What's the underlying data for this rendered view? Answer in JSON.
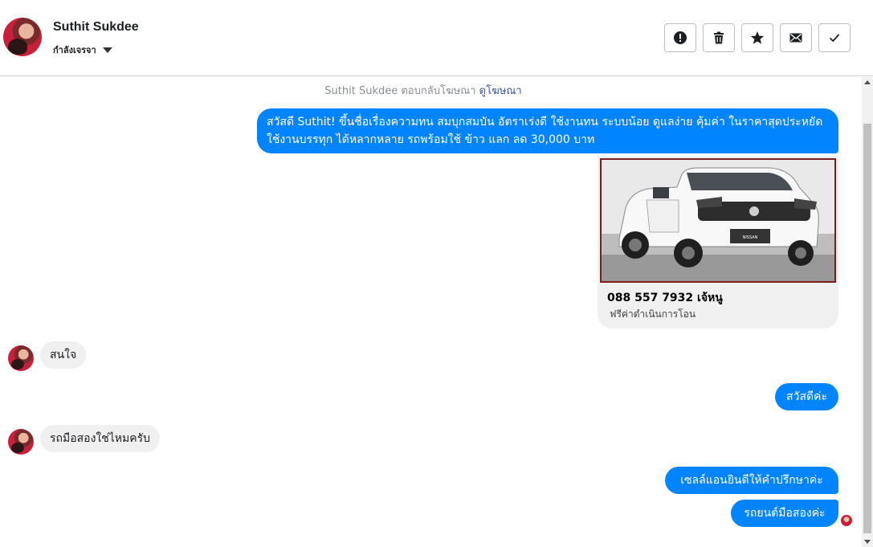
{
  "header": {
    "contact_name": "Suthit Sukdee",
    "stage_label": "กำลังเจรจา",
    "actions": [
      {
        "name": "spam-button",
        "icon": "exclamation-circle-icon"
      },
      {
        "name": "delete-button",
        "icon": "trash-icon"
      },
      {
        "name": "star-button",
        "icon": "star-icon"
      },
      {
        "name": "mark-unread-button",
        "icon": "envelope-icon"
      },
      {
        "name": "mark-done-button",
        "icon": "checkmark-icon"
      }
    ]
  },
  "chat": {
    "system_note": "Suthit Sukdee ตอบกลับโฆษณา",
    "system_note_link": "ดูโฆษณา",
    "messages": [
      {
        "side": "out",
        "text": "สวัสดี Suthit! ขึ้นชื่อเรื่องความทน สมบุกสมบัน อัตราเร่งดี ใช้งานทน ระบบน้อย ดูแลง่าย คุ้มค่า ในราคาสุดประหยัด ใช้งานบรรทุก ได้หลากหลาย รถพร้อมใช้ ข้าว แลก ลด 30,000 บาท"
      },
      {
        "side": "in",
        "text": "สนใจ"
      },
      {
        "side": "out",
        "text": "สวัสดีค่ะ"
      },
      {
        "side": "in",
        "text": "รถมือสองใช่ไหมครับ"
      },
      {
        "side": "out",
        "text": "เซลล์แอนยินดีให้คำปรึกษาค่ะ"
      },
      {
        "side": "out",
        "text": "รถยนต์มือสองค่ะ"
      }
    ],
    "ad_card": {
      "title": "088 557 7932 เจ้หนู",
      "subtitle": "ฟรีค่าดำเนินการโอน",
      "image": "white-pickup-truck-photo"
    }
  },
  "colors": {
    "outgoing_bubble": "#0084ff",
    "incoming_bubble": "#f0f0f0",
    "link": "#385898"
  }
}
